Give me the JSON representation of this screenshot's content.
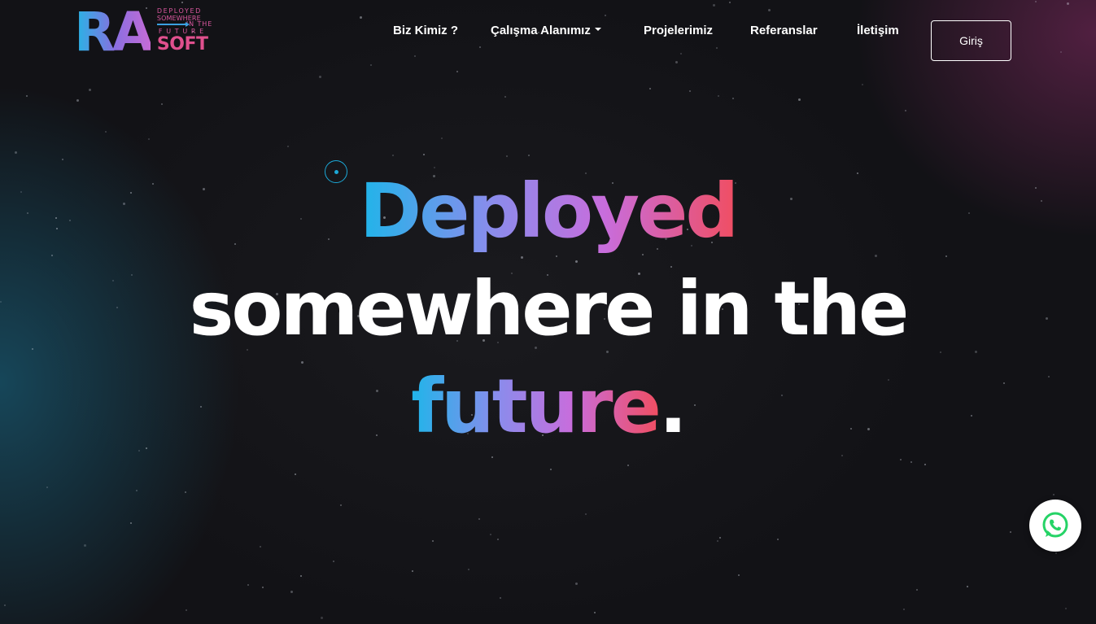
{
  "logo": {
    "letters": "RA",
    "tagline_lines": [
      "DEPLOYED",
      "SOMEWHERE",
      "IN THE",
      "FUTURE"
    ],
    "word": "SOFT",
    "colors": {
      "gradient_start": "#23b7e5",
      "gradient_end": "#c66bd6",
      "accent": "#e0508e"
    }
  },
  "nav": {
    "items": [
      {
        "label": "Biz Kimiz ?"
      },
      {
        "label": "Çalışma Alanımız",
        "has_dropdown": true
      },
      {
        "label": "Projelerimiz"
      },
      {
        "label": "Referanslar"
      },
      {
        "label": "İletişim"
      }
    ],
    "login_label": "Giriş"
  },
  "hero": {
    "line1": "Deployed",
    "line2": "somewhere in the",
    "line3_word": "future",
    "line3_period": ".",
    "gradient_colors": [
      "#1fb5e9",
      "#8a8cec",
      "#c86ddc",
      "#f04e62"
    ]
  },
  "floating": {
    "whatsapp_icon": "whatsapp-icon",
    "whatsapp_color": "#25d366"
  }
}
